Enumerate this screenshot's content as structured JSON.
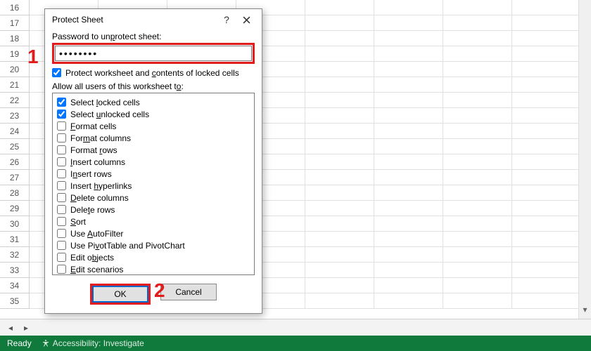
{
  "spreadsheet": {
    "visible_row_start": 16,
    "visible_row_end": 35,
    "statusbar": {
      "state": "Ready",
      "accessibility": "Accessibility: Investigate"
    }
  },
  "dialog": {
    "title": "Protect Sheet",
    "help_icon": "?",
    "password_label_pre": "Password to un",
    "password_label_u": "p",
    "password_label_post": "rotect sheet:",
    "password_value": "••••••••",
    "protect_pre": "Protect worksheet and ",
    "protect_u": "c",
    "protect_post": "ontents of locked cells",
    "protect_checked": true,
    "allow_label_pre": "Allow all users of this worksheet t",
    "allow_label_u": "o",
    "allow_label_post": ":",
    "permissions": [
      {
        "checked": true,
        "pre": "Select ",
        "u": "l",
        "post": "ocked cells"
      },
      {
        "checked": true,
        "pre": "Select ",
        "u": "u",
        "post": "nlocked cells"
      },
      {
        "checked": false,
        "pre": "",
        "u": "F",
        "post": "ormat cells"
      },
      {
        "checked": false,
        "pre": "For",
        "u": "m",
        "post": "at columns"
      },
      {
        "checked": false,
        "pre": "Format ",
        "u": "r",
        "post": "ows"
      },
      {
        "checked": false,
        "pre": "",
        "u": "I",
        "post": "nsert columns"
      },
      {
        "checked": false,
        "pre": "I",
        "u": "n",
        "post": "sert rows"
      },
      {
        "checked": false,
        "pre": "Insert ",
        "u": "h",
        "post": "yperlinks"
      },
      {
        "checked": false,
        "pre": "",
        "u": "D",
        "post": "elete columns"
      },
      {
        "checked": false,
        "pre": "Dele",
        "u": "t",
        "post": "e rows"
      },
      {
        "checked": false,
        "pre": "",
        "u": "S",
        "post": "ort"
      },
      {
        "checked": false,
        "pre": "Use ",
        "u": "A",
        "post": "utoFilter"
      },
      {
        "checked": false,
        "pre": "Use Pi",
        "u": "v",
        "post": "otTable and PivotChart"
      },
      {
        "checked": false,
        "pre": "Edit o",
        "u": "b",
        "post": "jects"
      },
      {
        "checked": false,
        "pre": "",
        "u": "E",
        "post": "dit scenarios"
      }
    ],
    "ok": "OK",
    "cancel": "Cancel"
  },
  "annotations": {
    "one": "1",
    "two": "2"
  }
}
